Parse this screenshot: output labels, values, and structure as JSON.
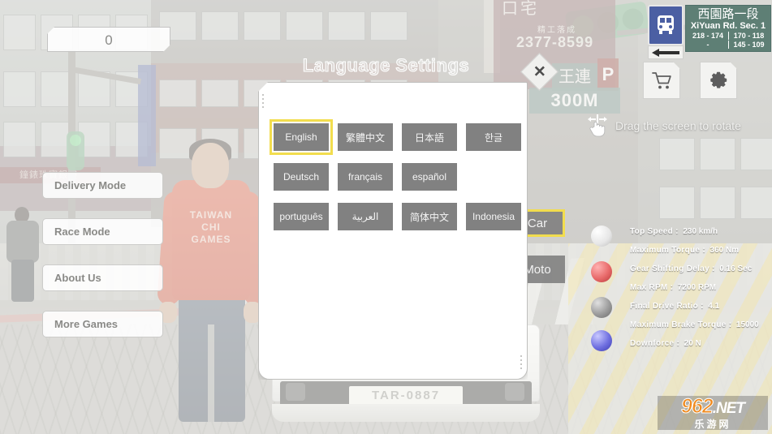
{
  "hud": {
    "counter_value": "0",
    "drag_hint": "Drag the screen to rotate",
    "menu_items": [
      {
        "label": "Delivery Mode"
      },
      {
        "label": "Race Mode"
      },
      {
        "label": "About Us"
      },
      {
        "label": "More Games"
      }
    ],
    "vehicle_buttons": [
      {
        "label": "Car",
        "selected": true
      },
      {
        "label": "Moto",
        "selected": false
      }
    ],
    "cart_icon": "shopping-cart-icon",
    "gear_icon": "gear-icon"
  },
  "street_sign": {
    "chinese": "西園路一段",
    "english": "XiYuan Rd. Sec. 1",
    "range_left_top": "218 - 174",
    "range_left_bottom": "-",
    "range_right_top": "170 - 118",
    "range_right_bottom": "145 - 109"
  },
  "scene_signage": {
    "billboard_top": "口宅",
    "billboard_mid": "精工落成",
    "billboard_phone": "2377-8599",
    "sign_wang": "王連",
    "sign_parking": "P",
    "sign_distance": "300M",
    "shop_sign": "鐘錶珠寶銀樓",
    "car_plate": "TAR-0887"
  },
  "stats": {
    "rows": [
      {
        "label": "Top Speed :",
        "value": "230 km/h"
      },
      {
        "label": "Maximum Torque :",
        "value": "360 Nm"
      },
      {
        "label": "Gear Shifting Delay :",
        "value": "0.16 Sec"
      },
      {
        "label": "Max RPM :",
        "value": "7200 RPM"
      },
      {
        "label": "Final Drive Ratio :",
        "value": "4.1"
      },
      {
        "label": "Maximum Brake Torque :",
        "value": "15000"
      },
      {
        "label": "Downforce :",
        "value": "20 N"
      }
    ]
  },
  "modal": {
    "title": "Language Settings",
    "close_label": "✕",
    "languages": [
      {
        "label": "English",
        "selected": true
      },
      {
        "label": "繁體中文",
        "selected": false
      },
      {
        "label": "日本語",
        "selected": false
      },
      {
        "label": "한글",
        "selected": false
      },
      {
        "label": "Deutsch",
        "selected": false
      },
      {
        "label": "français",
        "selected": false
      },
      {
        "label": "español",
        "selected": false
      },
      {
        "label": "",
        "selected": false
      },
      {
        "label": "português",
        "selected": false
      },
      {
        "label": "العربية",
        "selected": false
      },
      {
        "label": "简体中文",
        "selected": false
      },
      {
        "label": "Indonesia",
        "selected": false
      }
    ]
  },
  "watermark": {
    "num": "962",
    "net": ".NET",
    "cn": "乐游网"
  },
  "colors": {
    "accent_yellow": "#F2DD4E",
    "button_gray": "#818181",
    "panel_white": "#FFFFFF",
    "sign_green": "#5E7F75",
    "sign_blue": "#4B5FA3"
  }
}
